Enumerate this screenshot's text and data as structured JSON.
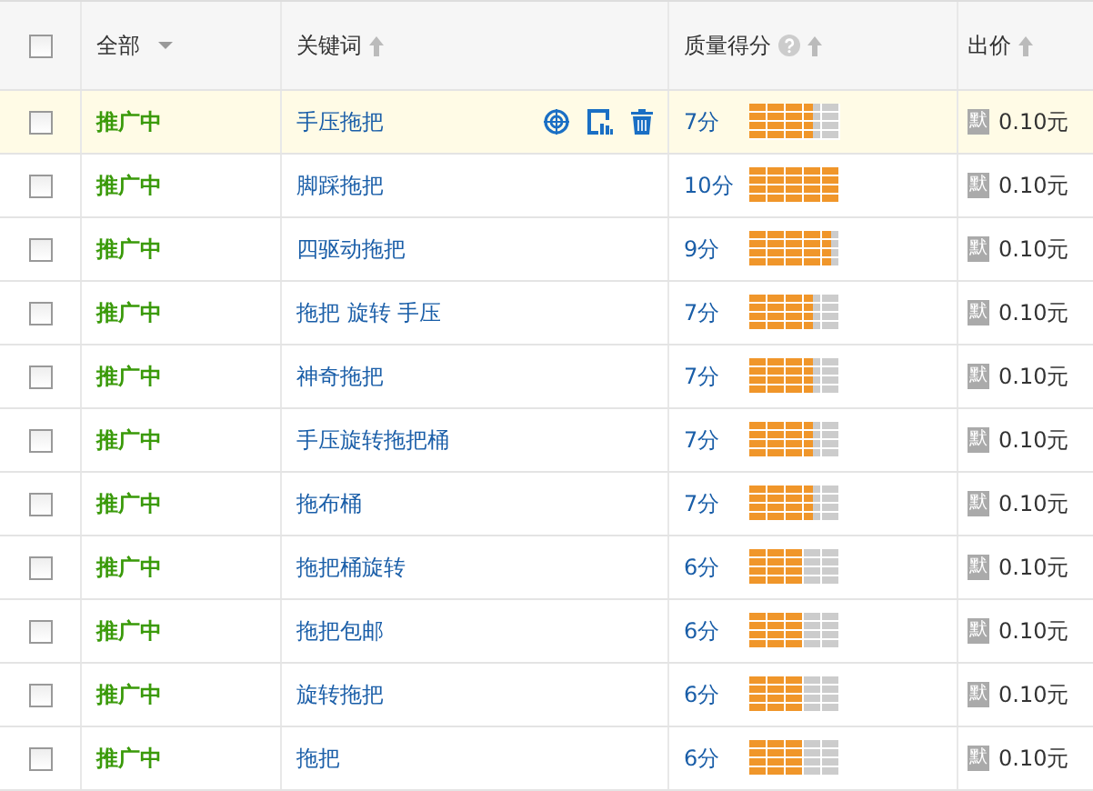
{
  "table": {
    "select_all_checked": false,
    "columns": [
      {
        "label": "全部",
        "kind": "dropdown"
      },
      {
        "label": "关键词",
        "kind": "sort"
      },
      {
        "label": "质量得分",
        "kind": "help-sort"
      },
      {
        "label": "出价",
        "kind": "sort"
      }
    ],
    "rows": [
      {
        "checked": false,
        "hovered": true,
        "status": "推广中",
        "keyword": "手压拖把",
        "score": "7分",
        "level": 0.7,
        "price_tag": "默",
        "price": "0.10元"
      },
      {
        "checked": false,
        "hovered": false,
        "status": "推广中",
        "keyword": "脚踩拖把",
        "score": "10分",
        "level": 1.0,
        "price_tag": "默",
        "price": "0.10元"
      },
      {
        "checked": false,
        "hovered": false,
        "status": "推广中",
        "keyword": "四驱动拖把",
        "score": "9分",
        "level": 0.9,
        "price_tag": "默",
        "price": "0.10元"
      },
      {
        "checked": false,
        "hovered": false,
        "status": "推广中",
        "keyword": "拖把 旋转 手压",
        "score": "7分",
        "level": 0.7,
        "price_tag": "默",
        "price": "0.10元"
      },
      {
        "checked": false,
        "hovered": false,
        "status": "推广中",
        "keyword": "神奇拖把",
        "score": "7分",
        "level": 0.7,
        "price_tag": "默",
        "price": "0.10元"
      },
      {
        "checked": false,
        "hovered": false,
        "status": "推广中",
        "keyword": "手压旋转拖把桶",
        "score": "7分",
        "level": 0.7,
        "price_tag": "默",
        "price": "0.10元"
      },
      {
        "checked": false,
        "hovered": false,
        "status": "推广中",
        "keyword": "拖布桶",
        "score": "7分",
        "level": 0.7,
        "price_tag": "默",
        "price": "0.10元"
      },
      {
        "checked": false,
        "hovered": false,
        "status": "推广中",
        "keyword": "拖把桶旋转",
        "score": "6分",
        "level": 0.6,
        "price_tag": "默",
        "price": "0.10元"
      },
      {
        "checked": false,
        "hovered": false,
        "status": "推广中",
        "keyword": "拖把包邮",
        "score": "6分",
        "level": 0.6,
        "price_tag": "默",
        "price": "0.10元"
      },
      {
        "checked": false,
        "hovered": false,
        "status": "推广中",
        "keyword": "旋转拖把",
        "score": "6分",
        "level": 0.6,
        "price_tag": "默",
        "price": "0.10元"
      },
      {
        "checked": false,
        "hovered": false,
        "status": "推广中",
        "keyword": "拖把",
        "score": "6分",
        "level": 0.6,
        "price_tag": "默",
        "price": "0.10元"
      }
    ]
  }
}
